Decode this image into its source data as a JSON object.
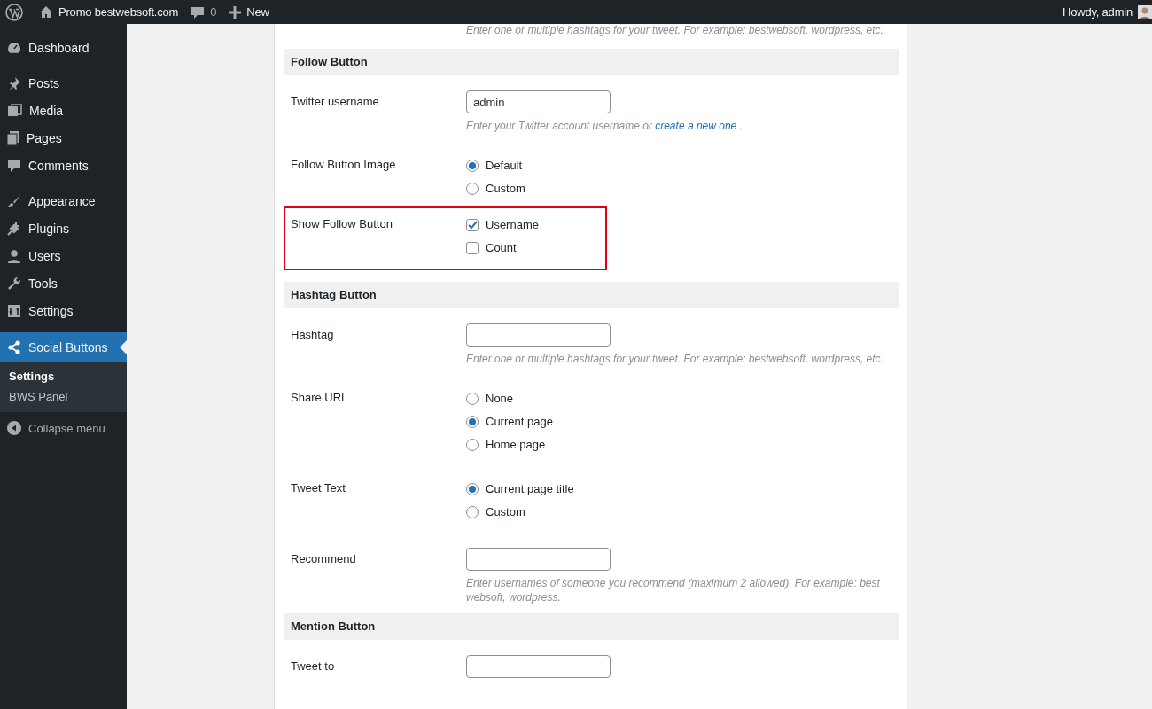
{
  "admin_bar": {
    "site": "Promo bestwebsoft.com",
    "comments": "0",
    "new": "New",
    "greeting": "Howdy, admin"
  },
  "menu": {
    "items": [
      {
        "label": "Dashboard",
        "selected": false
      },
      {
        "label": "Posts",
        "selected": false
      },
      {
        "label": "Media",
        "selected": false
      },
      {
        "label": "Pages",
        "selected": false
      },
      {
        "label": "Comments",
        "selected": false
      },
      {
        "label": "Appearance",
        "selected": false
      },
      {
        "label": "Plugins",
        "selected": false
      },
      {
        "label": "Users",
        "selected": false
      },
      {
        "label": "Tools",
        "selected": false
      },
      {
        "label": "Settings",
        "selected": false
      },
      {
        "label": "Social Buttons",
        "selected": true
      }
    ],
    "submenu": [
      {
        "label": "Settings",
        "selected": true
      },
      {
        "label": "BWS Panel",
        "selected": false
      }
    ],
    "collapse": "Collapse menu"
  },
  "form": [
    {
      "kind": "note",
      "text": "Enter one or multiple hashtags for your tweet. For example: bestwebsoft, wordpress, etc."
    },
    {
      "kind": "heading",
      "text": "Follow Button"
    },
    {
      "kind": "text",
      "label": "Twitter username",
      "value": "admin",
      "description": {
        "before": "Enter your Twitter account username or",
        "link": "create a new one",
        "after": "."
      }
    },
    {
      "kind": "radio",
      "label": "Follow Button Image",
      "options": [
        {
          "label": "Default",
          "selected": true
        },
        {
          "label": "Custom",
          "selected": false
        }
      ]
    },
    {
      "kind": "checkbox",
      "label": "Show Follow Button",
      "highlighted": true,
      "options": [
        {
          "label": "Username",
          "checked": true
        },
        {
          "label": "Count",
          "checked": false
        }
      ]
    },
    {
      "kind": "heading",
      "text": "Hashtag Button"
    },
    {
      "kind": "text",
      "label": "Hashtag",
      "description": {
        "before": "Enter one or multiple hashtags for your tweet. For example: bestwebsoft, wordpress, etc."
      }
    },
    {
      "kind": "radio",
      "label": "Share URL",
      "options": [
        {
          "label": "None",
          "selected": false
        },
        {
          "label": "Current page",
          "selected": true
        },
        {
          "label": "Home page",
          "selected": false
        }
      ]
    },
    {
      "kind": "radio",
      "label": "Tweet Text",
      "options": [
        {
          "label": "Current page title",
          "selected": true
        },
        {
          "label": "Custom",
          "selected": false
        }
      ]
    },
    {
      "kind": "text",
      "label": "Recommend",
      "description": {
        "before": "Enter usernames of someone you recommend (maximum 2 allowed). For example: bestwebsoft, wordpress."
      }
    },
    {
      "kind": "heading",
      "text": "Mention Button"
    },
    {
      "kind": "text",
      "label": "Tweet to"
    }
  ]
}
